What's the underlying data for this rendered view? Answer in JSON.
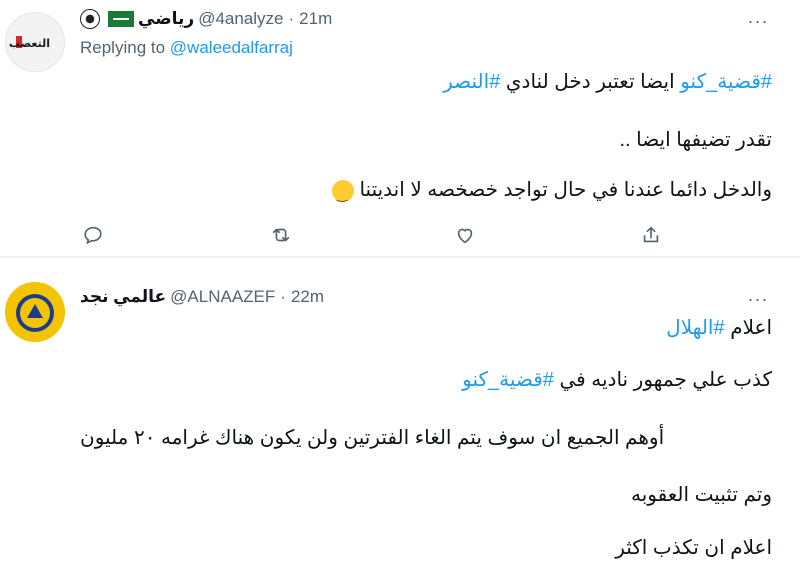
{
  "tweets": [
    {
      "display_name": "رياضي",
      "handle": "@4analyze",
      "separator": "·",
      "time": "21m",
      "avatar_text": "التعصب",
      "replying_label": "Replying to",
      "replying_handle": "@waleedalfarraj",
      "lines": [
        {
          "hashtag": "#قضية_كنو",
          "text": "ايضا تعتبر دخل لنادي",
          "hashtag2": "#النصر"
        },
        {
          "text": "تقدر تضيفها ايضا .."
        },
        {
          "text": "والدخل دائما عندنا في حال تواجد خصخصه لا انديتنا"
        }
      ],
      "icons": {
        "reply": "reply-icon",
        "retweet": "retweet-icon",
        "like": "like-icon",
        "share": "share-icon",
        "emoji": "winking-face-emoji"
      }
    },
    {
      "display_name": "عالمي نجد",
      "handle": "@ALNAAZEF",
      "separator": "·",
      "time": "22m",
      "lines": [
        {
          "text": "اعلام",
          "hashtag": "#الهلال"
        },
        {
          "text": "كذب علي جمهور ناديه في",
          "hashtag": "#قضية_كنو"
        },
        {
          "text": "أوهم الجميع ان سوف يتم الغاء الفترتين ولن يكون هناك غرامه ٢٠ مليون"
        },
        {
          "text": "وتم تثبيت العقوبه"
        },
        {
          "text": "اعلام ان تكذب اكثر"
        }
      ]
    }
  ],
  "more_label": "···",
  "colors": {
    "link": "#1d9bf0",
    "muted": "#536471",
    "text": "#0f1419",
    "divider": "#eff3f4"
  }
}
